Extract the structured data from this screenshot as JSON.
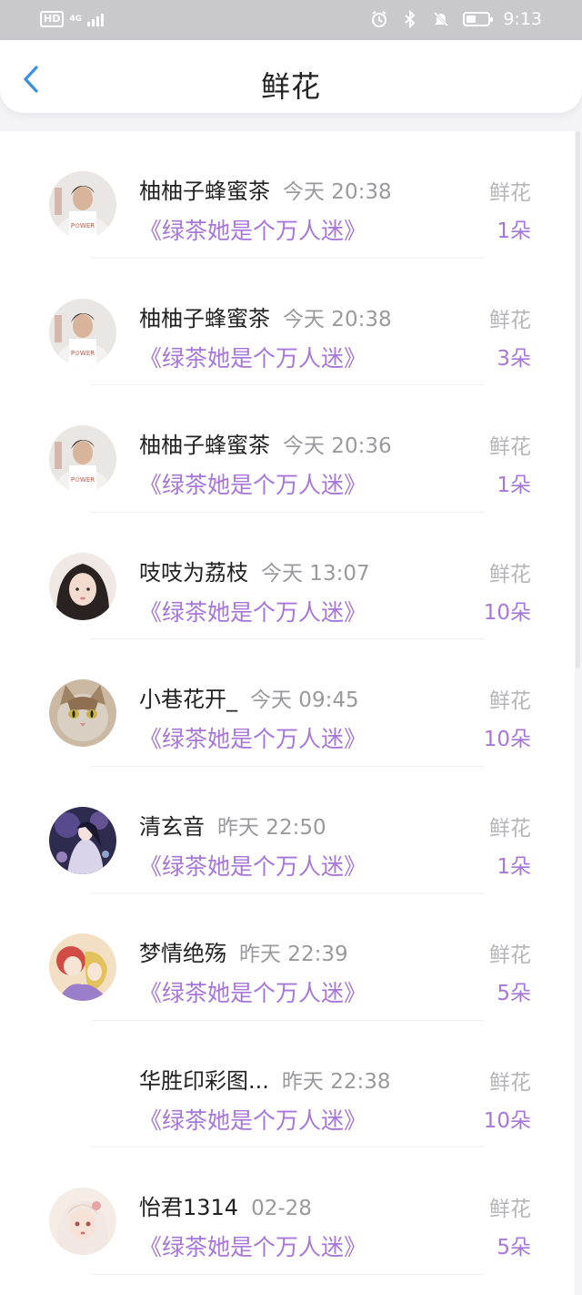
{
  "status_bar": {
    "left_badge": "HD",
    "network": "4G",
    "time": "9:13"
  },
  "nav": {
    "title": "鲜花",
    "back_icon": "chevron-left-icon"
  },
  "colors": {
    "accent_purple": "#a777d8",
    "back_blue": "#3a8ee6"
  },
  "list": [
    {
      "user": "柚柚子蜂蜜茶",
      "time": "今天 20:38",
      "book": "《绿茶她是个万人迷》",
      "gift": "鲜花",
      "count": "1朵",
      "avatar": "avatar-boy"
    },
    {
      "user": "柚柚子蜂蜜茶",
      "time": "今天 20:38",
      "book": "《绿茶她是个万人迷》",
      "gift": "鲜花",
      "count": "3朵",
      "avatar": "avatar-boy"
    },
    {
      "user": "柚柚子蜂蜜茶",
      "time": "今天 20:36",
      "book": "《绿茶她是个万人迷》",
      "gift": "鲜花",
      "count": "1朵",
      "avatar": "avatar-boy"
    },
    {
      "user": "吱吱为荔枝",
      "time": "今天 13:07",
      "book": "《绿茶她是个万人迷》",
      "gift": "鲜花",
      "count": "10朵",
      "avatar": "avatar-girl"
    },
    {
      "user": "小巷花开_",
      "time": "今天 09:45",
      "book": "《绿茶她是个万人迷》",
      "gift": "鲜花",
      "count": "10朵",
      "avatar": "avatar-cat"
    },
    {
      "user": "清玄音",
      "time": "昨天 22:50",
      "book": "《绿茶她是个万人迷》",
      "gift": "鲜花",
      "count": "1朵",
      "avatar": "avatar-anime"
    },
    {
      "user": "梦情绝殇",
      "time": "昨天 22:39",
      "book": "《绿茶她是个万人迷》",
      "gift": "鲜花",
      "count": "5朵",
      "avatar": "avatar-illustration"
    },
    {
      "user": "华胜印彩图...",
      "time": "昨天 22:38",
      "book": "《绿茶她是个万人迷》",
      "gift": "鲜花",
      "count": "10朵",
      "avatar": "none"
    },
    {
      "user": "怡君1314",
      "time": "02-28",
      "book": "《绿茶她是个万人迷》",
      "gift": "鲜花",
      "count": "5朵",
      "avatar": "avatar-doll"
    }
  ]
}
